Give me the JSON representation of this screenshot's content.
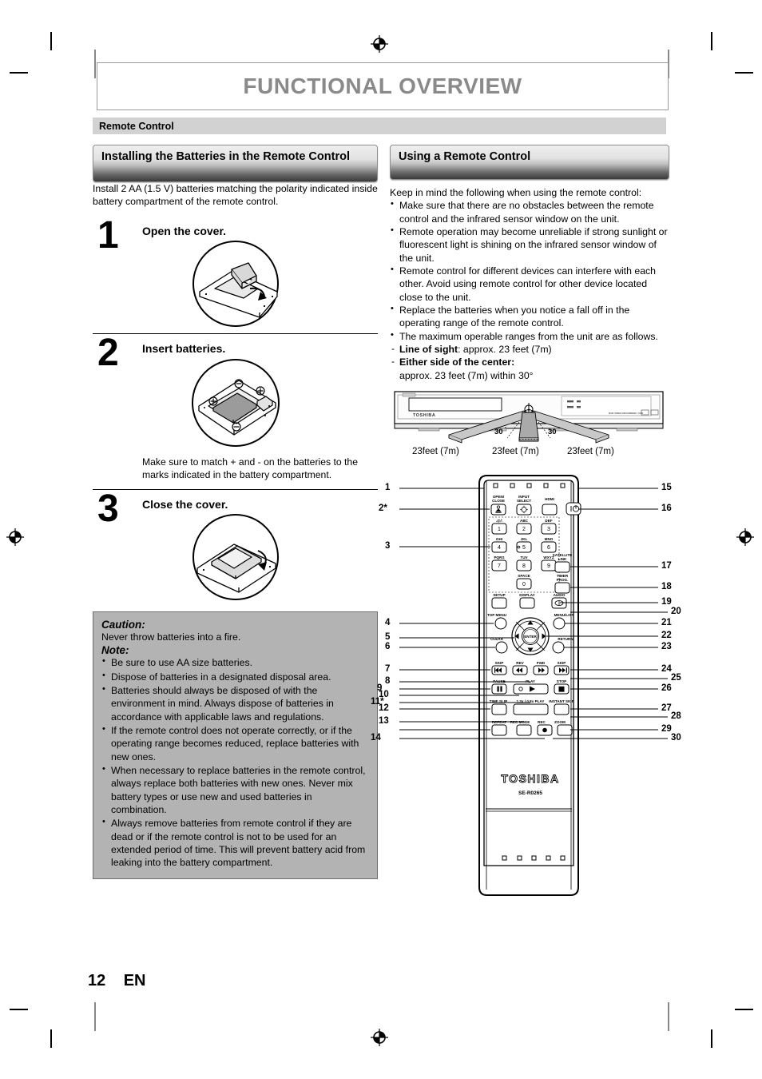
{
  "document": {
    "title": "FUNCTIONAL OVERVIEW",
    "section_band": "Remote Control",
    "page_number": "12",
    "language_code": "EN"
  },
  "left_column": {
    "header": "Installing the Batteries in the Remote Control",
    "intro": "Install 2 AA (1.5 V) batteries matching the polarity indicated inside battery compartment of the remote control.",
    "steps": [
      {
        "number": "1",
        "title": "Open the cover.",
        "caption": ""
      },
      {
        "number": "2",
        "title": "Insert batteries.",
        "caption": "Make sure to match + and - on the batteries to the marks indicated in the battery compartment."
      },
      {
        "number": "3",
        "title": "Close the cover.",
        "caption": ""
      }
    ],
    "caution": {
      "caution_label": "Caution:",
      "caution_text": "Never throw batteries into a fire.",
      "note_label": "Note:",
      "notes": [
        "Be sure to use AA size batteries.",
        "Dispose of batteries in a designated disposal area.",
        "Batteries should always be disposed of with the environment in mind. Always dispose of batteries in accordance with applicable laws and regulations.",
        "If the remote control does not operate correctly, or if the operating range becomes reduced, replace batteries with new ones.",
        "When necessary to replace batteries in the remote control, always replace both batteries with new ones. Never mix battery types or use new and used batteries in combination.",
        "Always remove batteries from remote control if they are dead or if the remote control is not to be used for an extended period of time. This will prevent battery acid from leaking into the battery compartment."
      ]
    }
  },
  "right_column": {
    "header": "Using a Remote Control",
    "intro": "Keep in mind the following when using the remote control:",
    "bullets": [
      "Make sure that there are no obstacles between the remote control and the infrared sensor window on the unit.",
      "Remote operation may become unreliable if strong sunlight or fluorescent light is shining on the infrared sensor window of the unit.",
      "Remote control for different devices can interfere with each other. Avoid using remote control for other device located close to the unit.",
      "Replace the batteries when you notice a fall off in the operating range of the remote control.",
      "The maximum operable ranges from the unit are as follows."
    ],
    "sub_items": [
      {
        "bold": "Line of sight",
        "text": ": approx. 23 feet (7m)"
      },
      {
        "bold": "Either side of the center:",
        "text": ""
      }
    ],
    "sub_items_extra": "approx. 23 feet (7m) within 30°",
    "unit_diagram": {
      "brand": "TOSHIBA",
      "angle_left": "30˚",
      "angle_right": "30˚",
      "range_left": "23feet (7m)",
      "range_center": "23feet (7m)",
      "range_right": "23feet (7m)"
    },
    "remote_diagram": {
      "brand": "TOSHIBA",
      "model": "SE-R0265",
      "button_labels": {
        "open_close": "OPEN/\nCLOSE",
        "input_select": "INPUT\nSELECT",
        "hdmi": "HDMI",
        "power": "I/⏻",
        "k1_letters": ".@/:",
        "k2_letters": "ABC",
        "k3_letters": "DEF",
        "k4_letters": "GHI",
        "k5_letters": "JKL",
        "k6_letters": "MNO",
        "k7_letters": "PQRS",
        "k8_letters": "TUV",
        "k9_letters": "WXYZ",
        "k0_letters": "SPACE",
        "key1": "1",
        "key2": "2",
        "key3": "3",
        "key4": "4",
        "key5": "5",
        "key6": "6",
        "key7": "7",
        "key8": "8",
        "key9": "9",
        "key0": "0",
        "satellite_link": "SATELLITE\nLINK",
        "timer_prog": "TIMER\nPROG.",
        "setup": "SETUP",
        "display": "DISPLAY",
        "audio": "AUDIO",
        "top_menu": "TOP MENU",
        "menu_list": "MENU/LIST",
        "enter": "ENTER",
        "clear": "CLEAR",
        "return": "RETURN",
        "skip_back": "SKIP",
        "rev": "REV",
        "fwd": "FWD",
        "skip_fwd": "SKIP",
        "pause": "PAUSE",
        "play": "PLAY",
        "stop": "STOP",
        "time_slip": "TIME SLIP",
        "speed_play": "1.3x / 0.8x PLAY",
        "instant_skip": "INSTANT SKIP",
        "repeat": "REPEAT",
        "rec_mode": "REC MODE",
        "rec": "REC",
        "zoom": "ZOOM"
      },
      "callouts_left": [
        "1",
        "2*",
        "3",
        "4",
        "5",
        "6",
        "7",
        "8",
        "9",
        "10",
        "11*",
        "12",
        "13",
        "14"
      ],
      "callouts_right": [
        "15",
        "16",
        "17",
        "18",
        "19",
        "20",
        "21",
        "22",
        "23",
        "24",
        "25",
        "26",
        "27",
        "28",
        "29",
        "30"
      ]
    }
  },
  "colors": {
    "title_gray": "#8a8a8a",
    "band_gray": "#d2d2d2",
    "callout_bg": "#b3b3b3",
    "header_dark": "#3a3a3a"
  }
}
